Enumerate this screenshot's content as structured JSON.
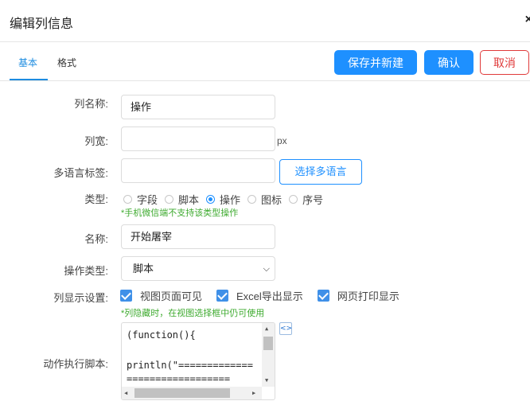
{
  "dialog": {
    "title": "编辑列信息",
    "close_icon": "close-icon"
  },
  "tabs": [
    {
      "label": "基本",
      "active": true
    },
    {
      "label": "格式",
      "active": false
    }
  ],
  "toolbar": {
    "save_new_label": "保存并新建",
    "confirm_label": "确认",
    "cancel_label": "取消"
  },
  "form": {
    "column_name": {
      "label": "列名称:",
      "value": "操作"
    },
    "column_width": {
      "label": "列宽:",
      "value": "",
      "unit": "px"
    },
    "multilang": {
      "label": "多语言标签:",
      "value": "",
      "button": "选择多语言"
    },
    "type": {
      "label": "类型:",
      "options": [
        "字段",
        "脚本",
        "操作",
        "图标",
        "序号"
      ],
      "selected": "操作",
      "hint": "*手机微信端不支持该类型操作"
    },
    "name": {
      "label": "名称:",
      "value": "开始屠宰"
    },
    "action_type": {
      "label": "操作类型:",
      "value": "脚本"
    },
    "display": {
      "label": "列显示设置:",
      "options": [
        "视图页面可见",
        "Excel导出显示",
        "网页打印显示"
      ],
      "hint": "*列隐藏时，在视图选择框中仍可使用"
    },
    "script": {
      "label": "动作执行脚本:",
      "lines": [
        "(function(){",
        "",
        "println(\"=============",
        "=================="
      ]
    }
  },
  "colors": {
    "primary": "#1e90ff",
    "danger": "#e03a3a",
    "hint": "#3fab30"
  }
}
